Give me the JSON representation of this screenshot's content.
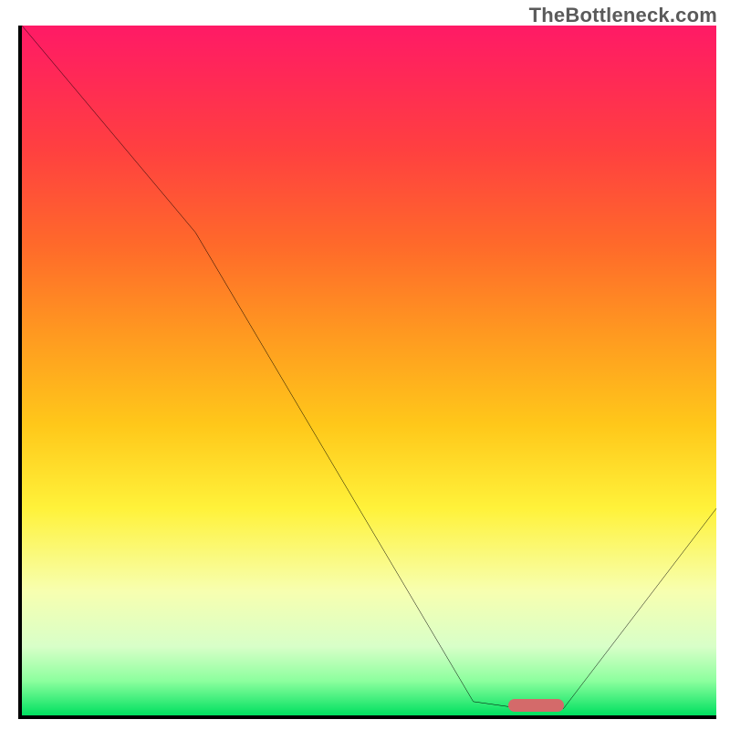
{
  "watermark": "TheBottleneck.com",
  "chart_data": {
    "type": "line",
    "title": "",
    "xlabel": "",
    "ylabel": "",
    "xlim": [
      0,
      100
    ],
    "ylim": [
      0,
      100
    ],
    "grid": false,
    "legend": null,
    "background_gradient": {
      "direction": "vertical",
      "stops": [
        {
          "pos": 0,
          "color": "#ff1a66"
        },
        {
          "pos": 18,
          "color": "#ff4040"
        },
        {
          "pos": 45,
          "color": "#ff9a20"
        },
        {
          "pos": 70,
          "color": "#fff23a"
        },
        {
          "pos": 90,
          "color": "#d8ffc8"
        },
        {
          "pos": 100,
          "color": "#00e060"
        }
      ]
    },
    "series": [
      {
        "name": "bottleneck-curve",
        "x": [
          0,
          25,
          65,
          72,
          78,
          100
        ],
        "y": [
          100,
          70,
          2,
          1,
          1,
          30
        ],
        "stroke": "#000000",
        "stroke_width": 3
      }
    ],
    "marker": {
      "name": "optimal-range",
      "x_start": 70,
      "x_end": 78,
      "y": 1.5,
      "color": "#d46a6a"
    }
  }
}
